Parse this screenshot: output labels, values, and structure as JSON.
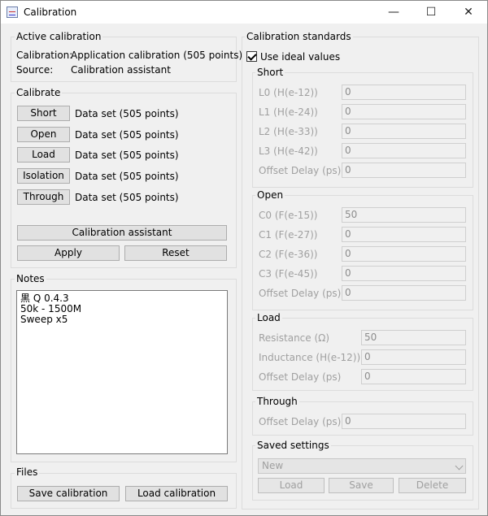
{
  "window": {
    "title": "Calibration",
    "minimize": "—",
    "maximize": "☐",
    "close": "✕"
  },
  "active": {
    "group": "Active calibration",
    "calibration_label": "Calibration:",
    "calibration_value": "Application calibration (505 points)",
    "source_label": "Source:",
    "source_value": "Calibration assistant"
  },
  "calibrate": {
    "group": "Calibrate",
    "rows": [
      {
        "button": "Short",
        "status": "Data set (505 points)"
      },
      {
        "button": "Open",
        "status": "Data set (505 points)"
      },
      {
        "button": "Load",
        "status": "Data set (505 points)"
      },
      {
        "button": "Isolation",
        "status": "Data set (505 points)"
      },
      {
        "button": "Through",
        "status": "Data set (505 points)"
      }
    ],
    "assistant": "Calibration assistant",
    "apply": "Apply",
    "reset": "Reset"
  },
  "notes": {
    "group": "Notes",
    "text": "黒 Q 0.4.3\n50k - 1500M\nSweep x5"
  },
  "files": {
    "group": "Files",
    "save": "Save calibration",
    "load": "Load calibration"
  },
  "standards": {
    "group": "Calibration standards",
    "ideal_label": "Use ideal values",
    "ideal_checked": true,
    "short": {
      "group": "Short",
      "fields": [
        {
          "label": "L0 (H(e-12))",
          "value": "0"
        },
        {
          "label": "L1 (H(e-24))",
          "value": "0"
        },
        {
          "label": "L2 (H(e-33))",
          "value": "0"
        },
        {
          "label": "L3 (H(e-42))",
          "value": "0"
        },
        {
          "label": "Offset Delay (ps)",
          "value": "0"
        }
      ]
    },
    "open": {
      "group": "Open",
      "fields": [
        {
          "label": "C0 (F(e-15))",
          "value": "50"
        },
        {
          "label": "C1 (F(e-27))",
          "value": "0"
        },
        {
          "label": "C2 (F(e-36))",
          "value": "0"
        },
        {
          "label": "C3 (F(e-45))",
          "value": "0"
        },
        {
          "label": "Offset Delay (ps)",
          "value": "0"
        }
      ]
    },
    "load": {
      "group": "Load",
      "fields": [
        {
          "label": "Resistance (Ω)",
          "value": "50"
        },
        {
          "label": "Inductance (H(e-12))",
          "value": "0"
        },
        {
          "label": "Offset Delay (ps)",
          "value": "0"
        }
      ]
    },
    "through": {
      "group": "Through",
      "fields": [
        {
          "label": "Offset Delay (ps)",
          "value": "0"
        }
      ]
    },
    "saved": {
      "group": "Saved settings",
      "selected": "New",
      "load": "Load",
      "save": "Save",
      "delete": "Delete"
    }
  }
}
